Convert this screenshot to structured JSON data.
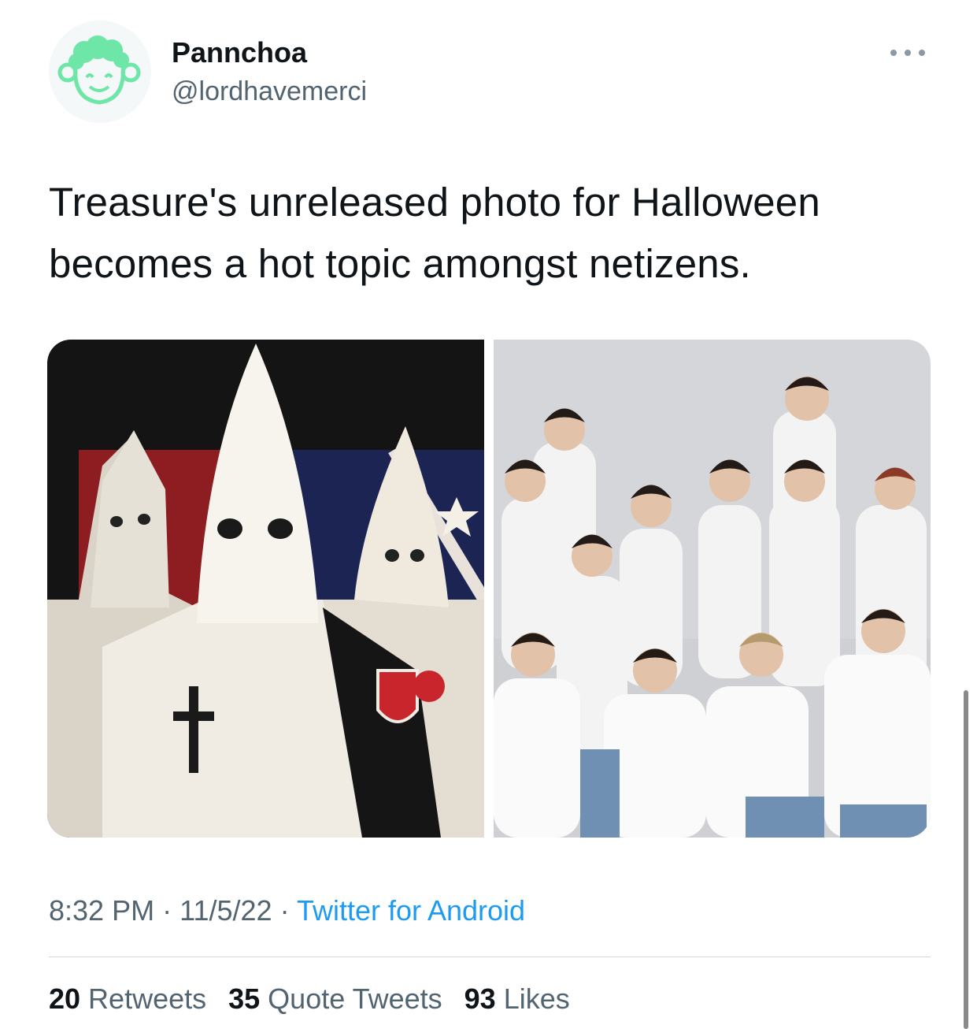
{
  "tweet": {
    "author": {
      "display_name": "Pannchoa",
      "handle": "@lordhavemerci",
      "avatar_icon": "cartoon-face-icon",
      "avatar_color": "#6ee6a8"
    },
    "text": "Treasure's unreleased photo for Halloween becomes a hot topic amongst netizens.",
    "media": [
      {
        "kind": "photo",
        "label": "Three people in white hooded robes in front of a flag"
      },
      {
        "kind": "photo",
        "label": "Group photo of twelve young men in white shirts and jeans"
      }
    ],
    "meta": {
      "time": "8:32 PM",
      "separator": "·",
      "date": "11/5/22",
      "source": "Twitter for Android"
    },
    "stats": {
      "retweets_count": "20",
      "retweets_label": "Retweets",
      "quotes_count": "35",
      "quotes_label": "Quote Tweets",
      "likes_count": "93",
      "likes_label": "Likes"
    }
  },
  "colors": {
    "text": "#0f1419",
    "secondary": "#536471",
    "link": "#1d9bf0",
    "divider": "#cfd9de"
  }
}
